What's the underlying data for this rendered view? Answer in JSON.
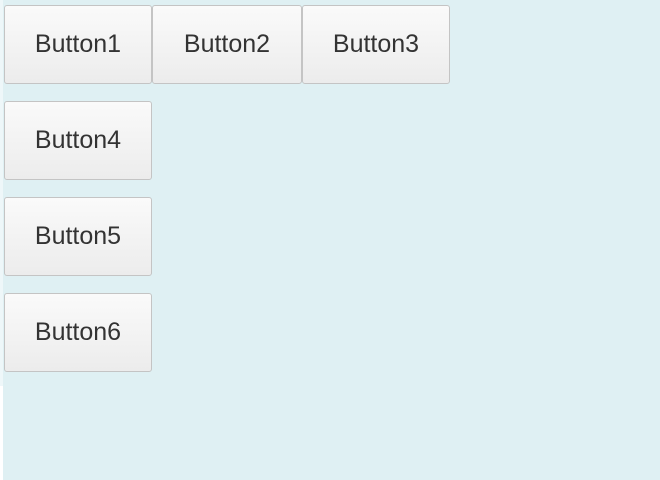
{
  "buttons": [
    {
      "label": "Button1"
    },
    {
      "label": "Button2"
    },
    {
      "label": "Button3"
    },
    {
      "label": "Button4"
    },
    {
      "label": "Button5"
    },
    {
      "label": "Button6"
    }
  ],
  "colors": {
    "panel_background": "#dff0f3",
    "button_border": "#c4c4c4",
    "button_text": "#333333"
  }
}
